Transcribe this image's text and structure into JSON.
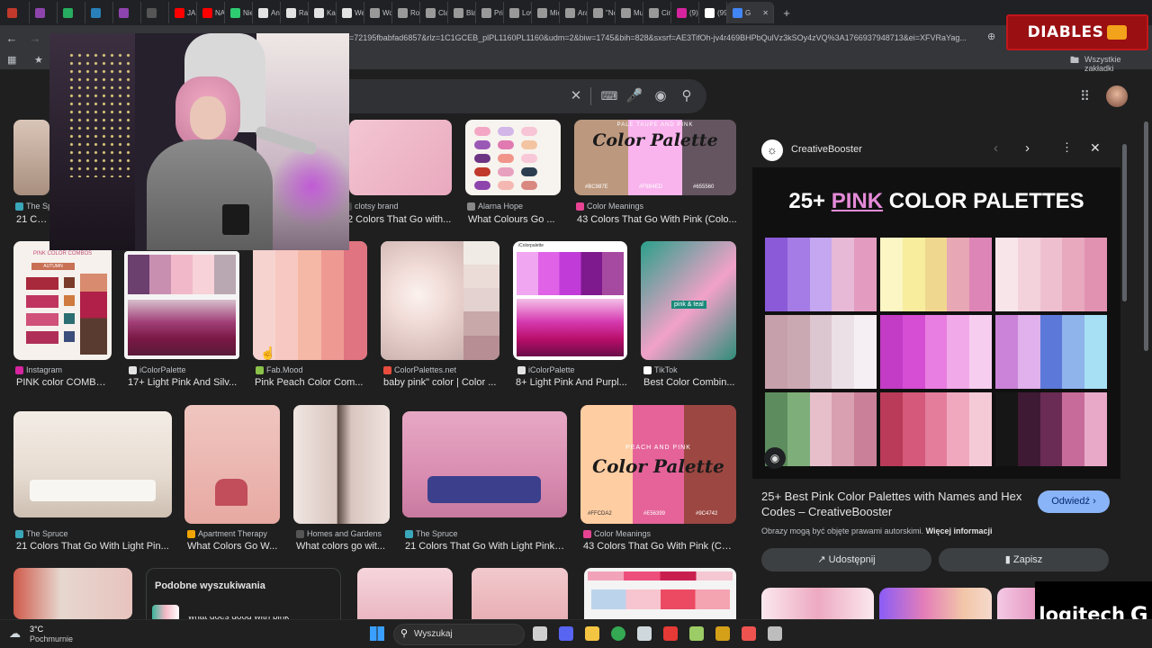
{
  "browser": {
    "tabs": [
      {
        "label": "",
        "color": "#c0392b"
      },
      {
        "label": "",
        "color": "#8e44ad"
      },
      {
        "label": "",
        "color": "#27ae60"
      },
      {
        "label": "",
        "color": "#2980b9"
      },
      {
        "label": "",
        "color": "#8e44ad"
      },
      {
        "label": "",
        "color": "#555555"
      },
      {
        "label": "JAD",
        "color": "#ff0000"
      },
      {
        "label": "NA",
        "color": "#ff0000"
      },
      {
        "label": "Nie",
        "color": "#2ecc71"
      },
      {
        "label": "Anı",
        "color": "#e3e3e3"
      },
      {
        "label": "Rafı",
        "color": "#e3e3e3"
      },
      {
        "label": "Kait",
        "color": "#e3e3e3"
      },
      {
        "label": "We",
        "color": "#e3e3e3"
      },
      {
        "label": "Wo",
        "color": "#999999"
      },
      {
        "label": "Ros",
        "color": "#999999"
      },
      {
        "label": "Clas",
        "color": "#999999"
      },
      {
        "label": "Blac",
        "color": "#999999"
      },
      {
        "label": "Prin",
        "color": "#999999"
      },
      {
        "label": "Lov",
        "color": "#999999"
      },
      {
        "label": "Mic",
        "color": "#999999"
      },
      {
        "label": "Aral",
        "color": "#999999"
      },
      {
        "label": "\"Nc",
        "color": "#999999"
      },
      {
        "label": "Mu:",
        "color": "#999999"
      },
      {
        "label": "Cin",
        "color": "#999999"
      },
      {
        "label": "(9)",
        "color": "#d6249f"
      },
      {
        "label": "(99",
        "color": "#ffffff"
      },
      {
        "label": "G",
        "color": "#4285f4",
        "active": true
      }
    ],
    "new_tab_label": "+",
    "address": "=72195fbabfad6857&rlz=1C1GCEB_plPL1160PL1160&udm=2&biw=1745&bih=828&sxsrf=AE3TifOh-jv4r469BHPbQulVz3kSOy4zVQ%3A1766937948713&ei=XFVRaYag...",
    "all_bookmarks": "Wszystkie zakładki"
  },
  "overlays": {
    "brand_text": "DIABLES",
    "logitech_text": "logitech"
  },
  "results": {
    "row1": [
      {
        "source": "The Sp",
        "title": "21 Colo",
        "fav": "#3aa6b9"
      },
      {
        "source": "clotsy brand",
        "title": "2 Colors That Go with...",
        "fav": "#444444"
      },
      {
        "source": "Alarna Hope",
        "title": "What Colours Go ...",
        "fav": "#888888"
      },
      {
        "source": "Color Meanings",
        "title": "43 Colors That Go With Pink (Colo...",
        "fav": "#e84393"
      }
    ],
    "row2": [
      {
        "source": "Instagram",
        "title": "PINK color COMBO...",
        "fav": "#d6249f"
      },
      {
        "source": "iColorPalette",
        "title": "17+ Light Pink And Silv...",
        "fav": "#e3e3e3"
      },
      {
        "source": "Fab.Mood",
        "title": "Pink Peach Color Com...",
        "fav": "#8bc34a"
      },
      {
        "source": "ColorPalettes.net",
        "title": "baby pink\" color | Color ...",
        "fav": "#e74c3c"
      },
      {
        "source": "iColorPalette",
        "title": "8+ Light Pink And Purpl...",
        "fav": "#e3e3e3"
      },
      {
        "source": "TikTok",
        "title": "Best Color Combin...",
        "fav": "#ffffff"
      }
    ],
    "row3": [
      {
        "source": "The Spruce",
        "title": "21 Colors That Go With Light Pin...",
        "fav": "#3aa6b9"
      },
      {
        "source": "Apartment Therapy",
        "title": "What Colors Go W...",
        "fav": "#f0a500"
      },
      {
        "source": "Homes and Gardens",
        "title": "What colors go wit...",
        "fav": "#555555"
      },
      {
        "source": "The Spruce",
        "title": "21 Colors That Go With Light Pink f...",
        "fav": "#3aa6b9"
      },
      {
        "source": "Color Meanings",
        "title": "43 Colors That Go With Pink (Col...",
        "fav": "#e84393"
      }
    ],
    "thumb_texts": {
      "pale_taupe_sub": "PALE TAUPE AND PINK",
      "color_palette": "Color Palette",
      "pale_taupe_codes": [
        "#BC987E",
        "#F9B4ED",
        "#655560"
      ],
      "peach_sub": "PEACH AND PINK",
      "peach_codes": [
        "#FFCDA2",
        "#E56399",
        "#9C4742"
      ],
      "pink_combos_title": "PINK COLOR COMBOS",
      "pink_combos_sub": "AUTUMN",
      "icolorpalette_label": "iColorpalette",
      "tiktok_badge": "pink & teal"
    },
    "related": {
      "title": "Podobne wyszukiwania",
      "first_item": "what goes good with pink"
    }
  },
  "panel": {
    "source": "CreativeBooster",
    "image_title_prefix": "25+",
    "image_title_accent": "PINK",
    "image_title_suffix": "COLOR PALETTES",
    "result_title": "25+ Best Pink Color Palettes with Names and Hex Codes – CreativeBooster",
    "visit_label": "Odwiedź",
    "copyright": "Obrazy mogą być objęte prawami autorskimi.",
    "more_info": "Więcej informacji",
    "share_label": "Udostępnij",
    "save_label": "Zapisz",
    "accent_color": "#e48ad8",
    "palettes": [
      [
        "#8a5ad8",
        "#a57ce6",
        "#c4a7f0",
        "#e7b9d6",
        "#e39cc0"
      ],
      [
        "#fbf6c4",
        "#f7ed9d",
        "#f0d78f",
        "#e7a7b5",
        "#de85b7"
      ],
      [
        "#f8e5ea",
        "#f4d2dc",
        "#eec0cf",
        "#e8a9bf",
        "#e192b0"
      ],
      [
        "#c6a0ab",
        "#cba9b3",
        "#dcc6cf",
        "#ece0e7",
        "#f5eff3"
      ],
      [
        "#c23cc6",
        "#d54ed3",
        "#e87ee1",
        "#f2a9e9",
        "#f6cdef"
      ],
      [
        "#cb83d9",
        "#e0b1ec",
        "#5c78d9",
        "#8fb4ec",
        "#a7e0f4"
      ],
      [
        "#5d8d5e",
        "#7eae79",
        "#e7bfcb",
        "#d9a0b1",
        "#c98098"
      ],
      [
        "#b93b59",
        "#d4597b",
        "#e47d9c",
        "#f0a8be",
        "#f4cad6"
      ],
      [
        "#161616",
        "#3f1a34",
        "#6a2b55",
        "#c76b9a",
        "#e8a9c8"
      ]
    ]
  },
  "taskbar": {
    "temperature": "3°C",
    "weather": "Pochmurnie",
    "search_placeholder": "Wyszukaj"
  }
}
